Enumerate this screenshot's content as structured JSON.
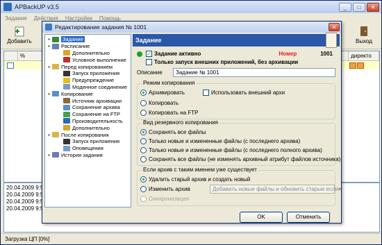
{
  "main": {
    "title": "APBackUP v3.5",
    "menu": [
      "Задания",
      "Действия",
      "Настройки",
      "Помощь"
    ],
    "toolbar": {
      "add_label": "Добавить",
      "exit_label": "Выход"
    },
    "grid": {
      "headers": [
        "%",
        "директо"
      ]
    },
    "log": [
      "20.04.2009 9:50",
      "20.04.2009 9:5",
      "20.04.2009 9:5",
      "20.04.2009 9:5"
    ],
    "status": "Загрузка ЦП [0%]"
  },
  "dialog": {
    "title": "Редактирование задания № 1001",
    "tree": [
      {
        "label": "Задание",
        "level": 0,
        "selected": true,
        "color": "#3a8a2e"
      },
      {
        "label": "Расписание",
        "level": 0,
        "color": "#6b7db3"
      },
      {
        "label": "Дополнительно",
        "level": 1,
        "color": "#d4a82a"
      },
      {
        "label": "Условное выполнение",
        "level": 1,
        "color": "#c03030"
      },
      {
        "label": "Перед копированием",
        "level": 0,
        "color": "#d9b44a"
      },
      {
        "label": "Запуск приложения",
        "level": 1,
        "color": "#333333"
      },
      {
        "label": "Предупреждение",
        "level": 1,
        "color": "#e0c020"
      },
      {
        "label": "Моденное соединение",
        "level": 1,
        "color": "#7a9ac8"
      },
      {
        "label": "Копирование",
        "level": 0,
        "color": "#5a8fc8"
      },
      {
        "label": "Источник архивации",
        "level": 1,
        "color": "#8a6a3a"
      },
      {
        "label": "Сохранение архива",
        "level": 1,
        "color": "#5a8fc8"
      },
      {
        "label": "Сохранение на FTP",
        "level": 1,
        "color": "#4aa04a"
      },
      {
        "label": "Производительность",
        "level": 1,
        "color": "#2a6ab0"
      },
      {
        "label": "Дополнительно",
        "level": 1,
        "color": "#d4a82a"
      },
      {
        "label": "После копирования",
        "level": 0,
        "color": "#d9b44a"
      },
      {
        "label": "Запуск приложения",
        "level": 1,
        "color": "#333333"
      },
      {
        "label": "Оповещения",
        "level": 1,
        "color": "#7a9ac8"
      },
      {
        "label": "История задания",
        "level": 0,
        "color": "#6b7db3"
      }
    ],
    "panel": {
      "header": "Задание",
      "active_label": "Задание активно",
      "number_label": "Номер",
      "number_value": "1001",
      "only_launch_label": "Только запуск внешних приложений, без архивации",
      "description_label": "Описание",
      "description_value": "Задание № 1001",
      "copy_mode": {
        "legend": "Режим копирования",
        "options": [
          "Архивировать",
          "Копировать",
          "Копировать на FTP"
        ],
        "external_label": "Использовать внешний архи"
      },
      "backup_type": {
        "legend": "Вид резервного копирования",
        "options": [
          "Сохранять все файлы",
          "Только новые и измененные файлы (с последнего архива)",
          "Только новые и измененные файлы (с последнего полного архива)",
          "Сохранять все файлы (не изменять архивный атрибут файлов источника)"
        ]
      },
      "exists": {
        "legend": "Если архив с таким именем уже существует",
        "options": [
          "Удалить старый архив и создать новый",
          "Изменить архив",
          "Синхронизация"
        ],
        "combo_value": "Добавить новые файлы и обновить старые если"
      }
    },
    "ok_label": "OK",
    "cancel_label": "Отменить"
  },
  "colors": {
    "selection": "#316ac5",
    "panel_header": "#2a57a7",
    "number": "#e0201f",
    "active_dot": "#21a121"
  }
}
